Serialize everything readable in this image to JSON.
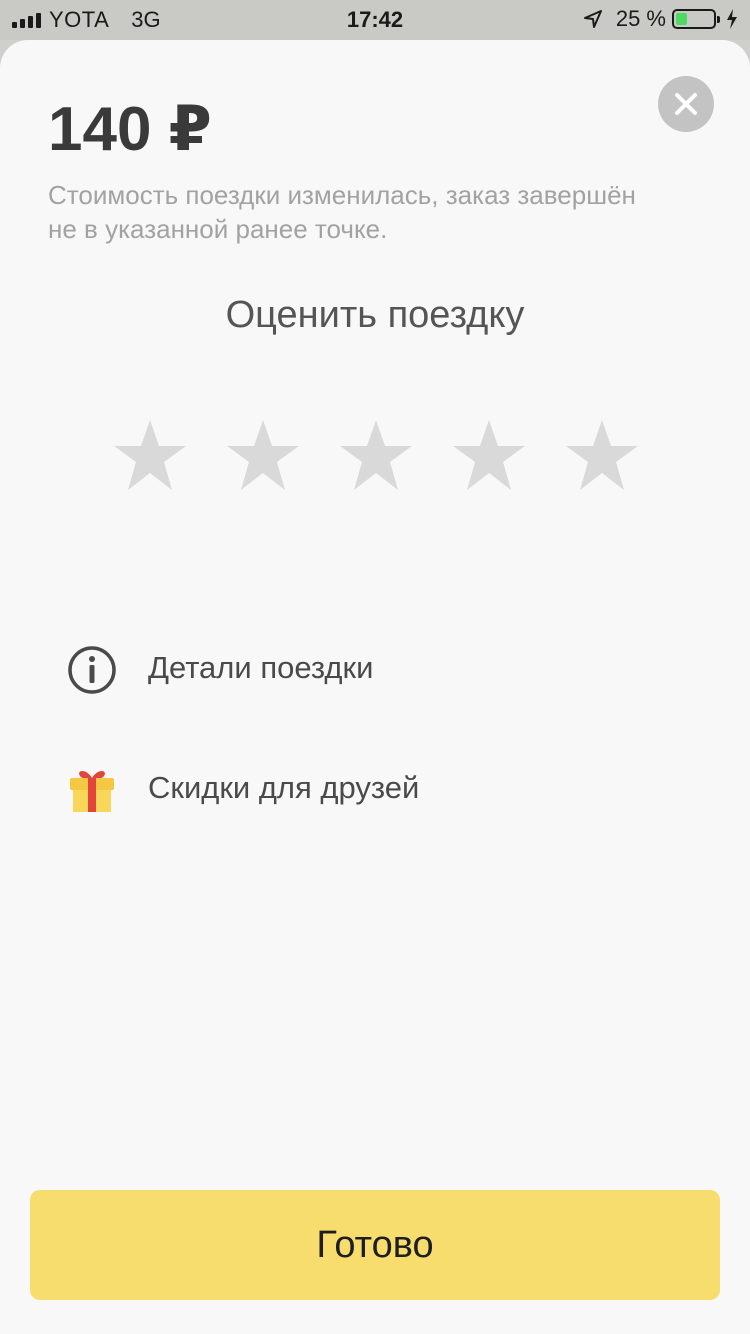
{
  "status_bar": {
    "carrier": "YOTA",
    "network": "3G",
    "time": "17:42",
    "battery": "25 %",
    "battery_level": 0.25
  },
  "ride": {
    "price": "140 ₽",
    "price_note": "Стоимость поездки изменилась, заказ завершён не в указанной ранее точке."
  },
  "rating": {
    "title": "Оценить поездку",
    "max_stars": 5,
    "selected": 0,
    "star_color": "#d9d9d9"
  },
  "menu": {
    "details_label": "Детали поездки",
    "details_icon": "info-icon",
    "friends_label": "Скидки для друзей",
    "friends_icon": "gift-icon"
  },
  "actions": {
    "done_label": "Готово",
    "accent_color": "#f7dd6d"
  }
}
